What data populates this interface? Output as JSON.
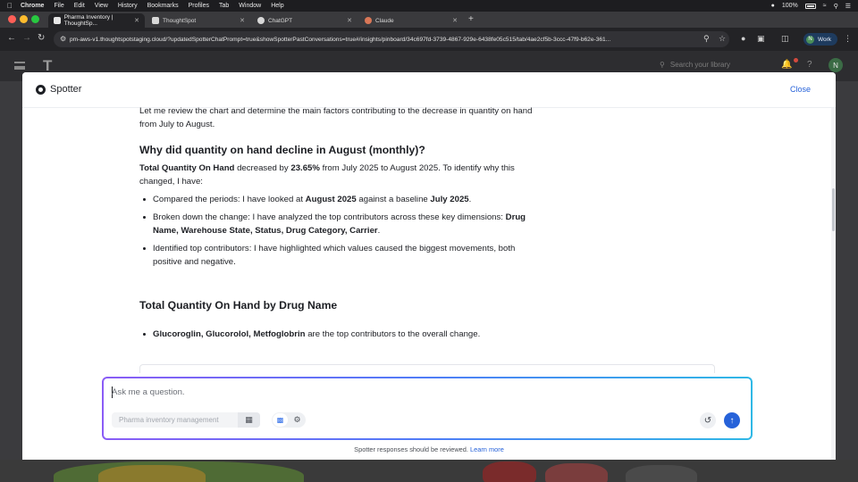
{
  "menubar": {
    "items": [
      "Chrome",
      "File",
      "Edit",
      "View",
      "History",
      "Bookmarks",
      "Profiles",
      "Tab",
      "Window",
      "Help"
    ],
    "battery": "100%"
  },
  "tabs": [
    {
      "label": "Pharma Inventory | ThoughtSp...",
      "active": true,
      "color": "#2f2f33"
    },
    {
      "label": "ThoughtSpot",
      "active": false,
      "color": "#d8d8d8"
    },
    {
      "label": "ChatGPT",
      "active": false,
      "color": "#d8d8d8"
    },
    {
      "label": "Claude",
      "active": false,
      "color": "#d97757"
    }
  ],
  "browser": {
    "url": "pm-aws-v1.thoughtspotstaging.cloud/?updatedSpotterChatPrompt=true&showSpotterPastConversations=true#/insights/pinboard/34c697fd-3739-4867-929e-6438fe05c515/tab/4ae2cf5b-3ccc-47f9-b62e-361...",
    "profile_label": "Work",
    "profile_initial": "N"
  },
  "app_header": {
    "search_placeholder": "Search your library",
    "user_initial": "N"
  },
  "spotter": {
    "title": "Spotter",
    "close_label": "Close",
    "intro": "Let me review the chart and determine the main factors contributing to the decrease in quantity on hand from July to August.",
    "heading": "Why did quantity on hand decline in August (monthly)?",
    "summary": {
      "metric": "Total Quantity On Hand",
      "mid1": " decreased by ",
      "pct": "23.65%",
      "mid2": " from July 2025 to August 2025. To identify why this changed, I have:"
    },
    "bullets": {
      "b1_pre": "Compared the periods: I have looked at ",
      "b1_a": "August 2025",
      "b1_mid": " against a baseline ",
      "b1_b": "July 2025",
      "b1_post": ".",
      "b2_pre": "Broken down the change: I have analyzed the top contributors across these key dimensions: ",
      "b2_dims": "Drug Name, Warehouse State, Status, Drug Category, Carrier",
      "b2_post": ".",
      "b3": "Identified top contributors: I have highlighted which values caused the biggest movements, both positive and negative."
    },
    "section_heading": "Total Quantity On Hand by Drug Name",
    "contrib": {
      "names": "Glucoroglin, Glucorolol, Metfoglobrin",
      "rest": " are the top contributors to the overall change."
    },
    "input": {
      "placeholder": "Ask me a question.",
      "datasource": "Pharma inventory management"
    },
    "disclaimer": "Spotter responses should be reviewed.",
    "learn_more": "Learn more"
  }
}
